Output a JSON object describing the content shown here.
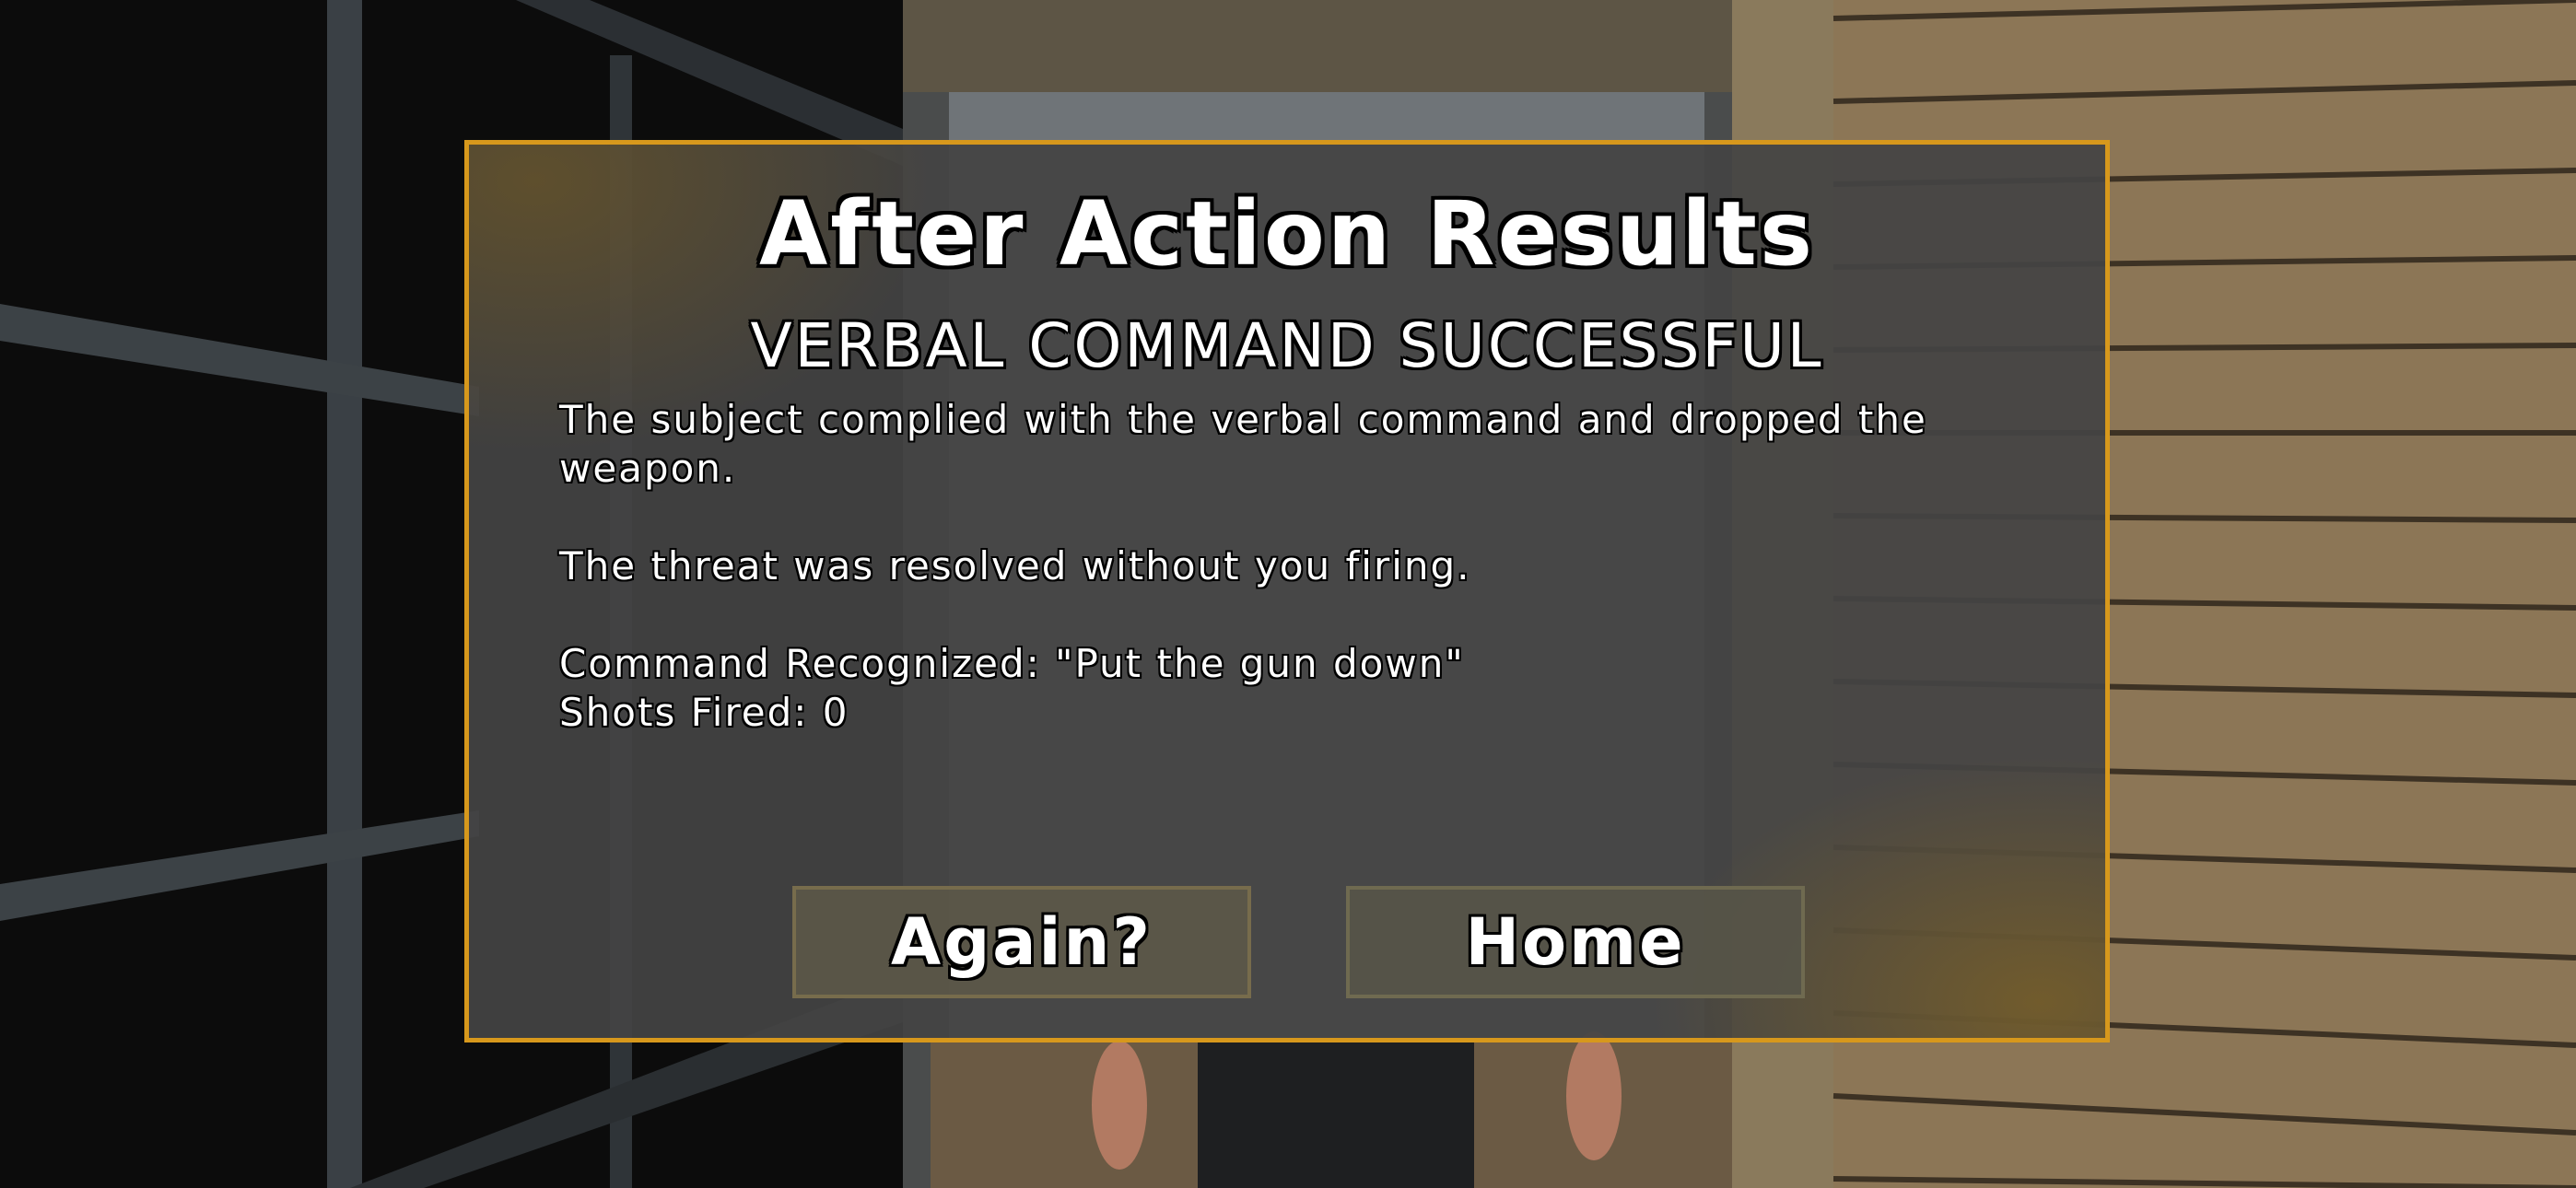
{
  "dialog": {
    "title": "After Action Results",
    "subtitle": "VERBAL COMMAND SUCCESSFUL",
    "lines": [
      "The subject complied with the verbal command and dropped the weapon.",
      "The threat was resolved without you firing.",
      "Command Recognized: \"Put the gun down\"",
      "Shots Fired: 0"
    ]
  },
  "buttons": {
    "again_label": "Again?",
    "home_label": "Home"
  },
  "colors": {
    "dialog_border": "#d7981c",
    "dialog_background": "#444444",
    "button_background": "#5c5848",
    "text": "#ffffff"
  }
}
